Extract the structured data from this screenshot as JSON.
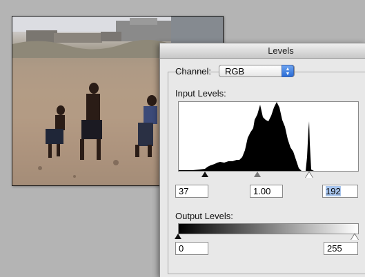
{
  "dialog": {
    "title": "Levels",
    "channel_label": "Channel:",
    "channel_value": "RGB",
    "input_levels_label": "Input Levels:",
    "input_black": "37",
    "input_gamma": "1.00",
    "input_white": "192",
    "output_levels_label": "Output Levels:",
    "output_black": "0",
    "output_white": "255"
  },
  "icons": {
    "channel_dropdown": "up-down-arrows-icon",
    "black_point": "black-triangle-icon",
    "gamma_point": "gray-triangle-icon",
    "white_point": "white-triangle-icon"
  },
  "colors": {
    "selection_highlight": "#a9c6ee",
    "dropdown_accent": "#2a6cd6"
  }
}
